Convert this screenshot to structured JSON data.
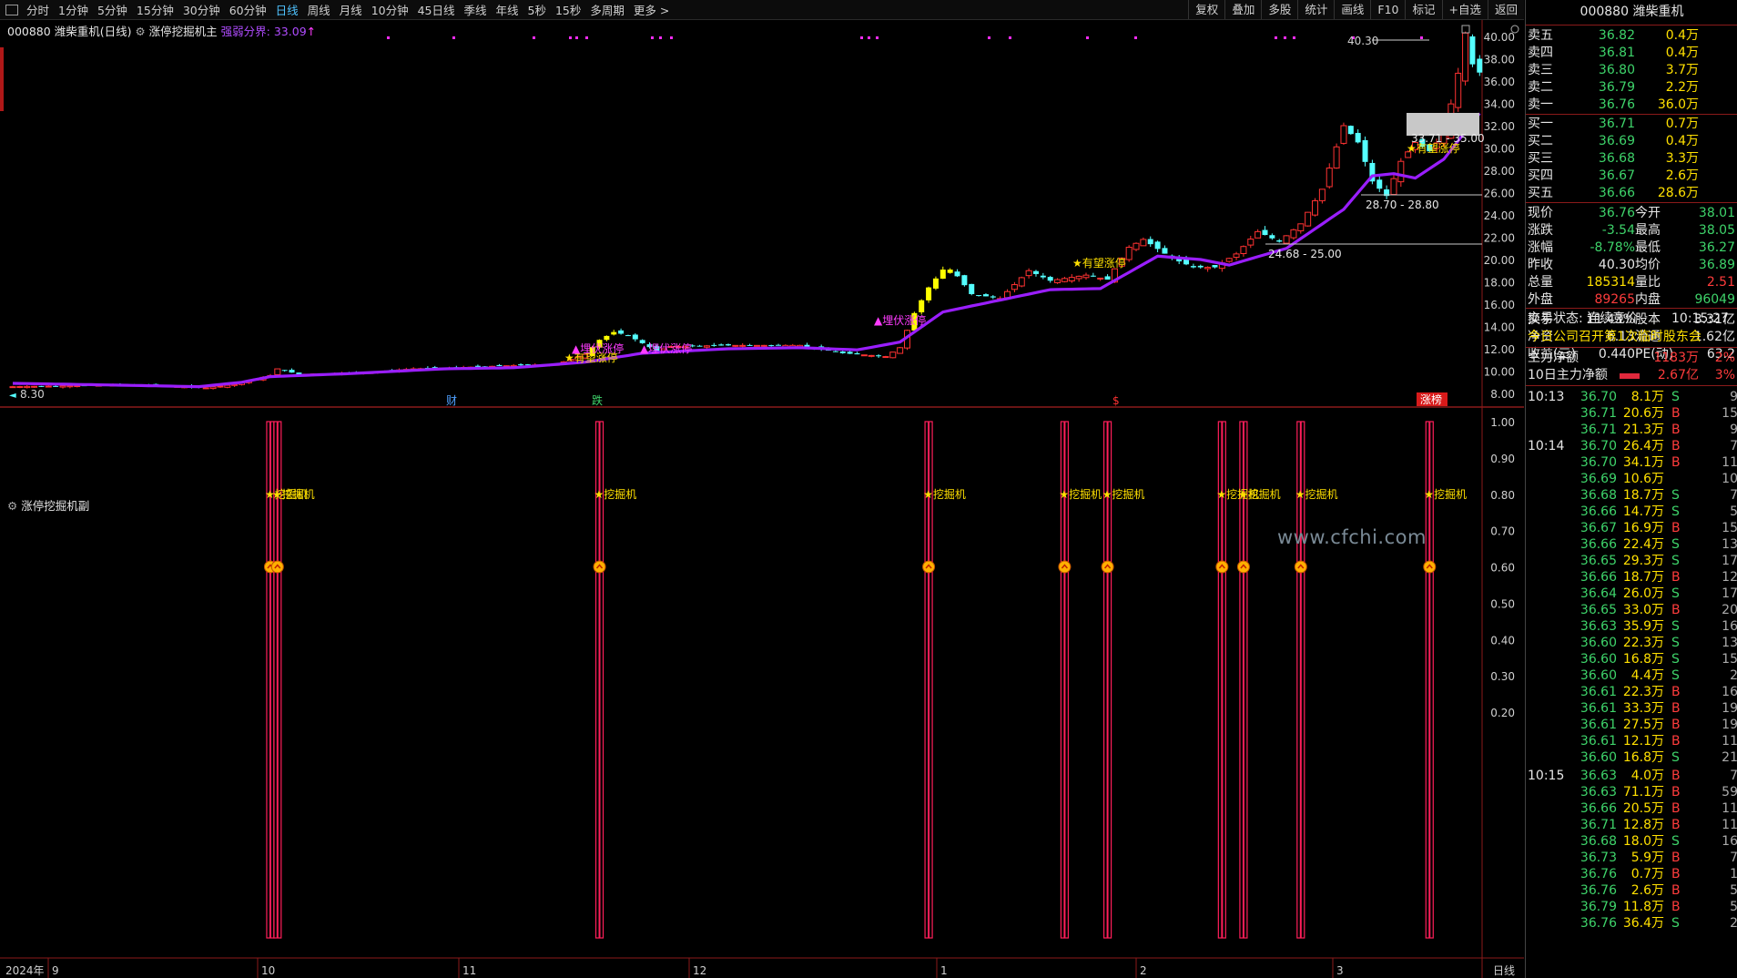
{
  "stock": {
    "code": "000880",
    "name": "潍柴重机",
    "period_label": "(日线)"
  },
  "toolbar": {
    "periods": [
      "分时",
      "1分钟",
      "5分钟",
      "15分钟",
      "30分钟",
      "60分钟",
      "日线",
      "周线",
      "月线",
      "10分钟",
      "45日线",
      "季线",
      "年线",
      "5秒",
      "15秒",
      "多周期",
      "更多 >"
    ],
    "active_period": "日线",
    "tools": [
      "复权",
      "叠加",
      "多股",
      "统计",
      "画线",
      "F10",
      "标记",
      "+自选",
      "返回"
    ]
  },
  "main_panel": {
    "indicator": "涨停挖掘机主",
    "gauge_label": "强弱分界: 33.09",
    "gauge_arrow": "↑"
  },
  "sub_panel": {
    "indicator": "涨停挖掘机副",
    "signal_label": "★挖掘机"
  },
  "watermark": "www.cfchi.com",
  "colors": {
    "up": "#ff3232",
    "down": "#54ffff",
    "ma": "#9a1eff",
    "highlight": "#ffff00",
    "signal": "#ff1e5a"
  },
  "annotations": {
    "top_price": "40.30",
    "box_label": "33.71 - 35.00",
    "level_label_1": "28.70 - 28.80",
    "level_label_2": "24.68 - 25.00",
    "low_price": "8.30",
    "hope": "★有望涨停",
    "ambush": "▲埋伏涨停",
    "event_cai": "财",
    "event_die": "跌",
    "event_s": "$",
    "event_zhang": "涨榜"
  },
  "x_axis": {
    "year": "2024年",
    "months": [
      "9",
      "10",
      "11",
      "12",
      "1",
      "2",
      "3"
    ],
    "period_tag": "日线"
  },
  "chart_data": {
    "type": "candlestick",
    "y_axis_main": {
      "min": 8,
      "max": 40,
      "ticks": [
        "40.00",
        "38.00",
        "36.00",
        "34.00",
        "32.00",
        "30.00",
        "28.00",
        "26.00",
        "24.00",
        "22.00",
        "20.00",
        "18.00",
        "16.00",
        "14.00",
        "12.00",
        "10.00",
        "8.00"
      ]
    },
    "y_axis_sub": {
      "min": 0.2,
      "max": 1.0,
      "ticks": [
        "1.00",
        "0.90",
        "0.80",
        "0.70",
        "0.60",
        "0.50",
        "0.40",
        "0.30",
        "0.20"
      ]
    },
    "ohlc_anchors": [
      {
        "i": 0,
        "c": 8.6
      },
      {
        "i": 10,
        "c": 8.7
      },
      {
        "i": 17,
        "c": 8.8
      },
      {
        "i": 27,
        "c": 8.5
      },
      {
        "i": 31,
        "c": 8.8
      },
      {
        "i": 36,
        "c": 9.6
      },
      {
        "i": 37,
        "c": 10.2
      },
      {
        "i": 40,
        "c": 9.7
      },
      {
        "i": 50,
        "c": 9.9
      },
      {
        "i": 56,
        "c": 10.2
      },
      {
        "i": 62,
        "c": 10.3
      },
      {
        "i": 70,
        "c": 10.5
      },
      {
        "i": 76,
        "c": 10.6
      },
      {
        "i": 80,
        "c": 11.5
      },
      {
        "i": 82,
        "c": 12.8
      },
      {
        "i": 84,
        "c": 13.5
      },
      {
        "i": 86,
        "c": 13.2
      },
      {
        "i": 88,
        "c": 12.5
      },
      {
        "i": 90,
        "c": 11.8
      },
      {
        "i": 92,
        "c": 12.2
      },
      {
        "i": 100,
        "c": 12.3
      },
      {
        "i": 110,
        "c": 12.3
      },
      {
        "i": 116,
        "c": 11.6
      },
      {
        "i": 122,
        "c": 11.3
      },
      {
        "i": 124,
        "c": 12.1
      },
      {
        "i": 126,
        "c": 15.2
      },
      {
        "i": 128,
        "c": 17.5
      },
      {
        "i": 130,
        "c": 19.1
      },
      {
        "i": 132,
        "c": 18.5
      },
      {
        "i": 134,
        "c": 16.9
      },
      {
        "i": 138,
        "c": 16.5
      },
      {
        "i": 142,
        "c": 19.0
      },
      {
        "i": 145,
        "c": 18.1
      },
      {
        "i": 150,
        "c": 18.6
      },
      {
        "i": 153,
        "c": 18.2
      },
      {
        "i": 156,
        "c": 21.1
      },
      {
        "i": 158,
        "c": 21.8
      },
      {
        "i": 162,
        "c": 20.1
      },
      {
        "i": 165,
        "c": 19.3
      },
      {
        "i": 168,
        "c": 19.3
      },
      {
        "i": 171,
        "c": 20.5
      },
      {
        "i": 174,
        "c": 22.5
      },
      {
        "i": 177,
        "c": 21.6
      },
      {
        "i": 180,
        "c": 23.2
      },
      {
        "i": 183,
        "c": 26.3
      },
      {
        "i": 186,
        "c": 32.0
      },
      {
        "i": 188,
        "c": 30.5
      },
      {
        "i": 190,
        "c": 27.0
      },
      {
        "i": 192,
        "c": 25.7
      },
      {
        "i": 194,
        "c": 28.8
      },
      {
        "i": 196,
        "c": 30.5
      },
      {
        "i": 198,
        "c": 29.7
      },
      {
        "i": 200,
        "c": 31.2
      },
      {
        "i": 202,
        "c": 36.7
      },
      {
        "i": 203,
        "c": 40.3
      },
      {
        "i": 204,
        "c": 37.5
      },
      {
        "i": 205,
        "c": 36.76
      }
    ],
    "ma_anchors": [
      {
        "i": 0,
        "v": 8.9
      },
      {
        "i": 14,
        "v": 8.75
      },
      {
        "i": 26,
        "v": 8.6
      },
      {
        "i": 32,
        "v": 9.0
      },
      {
        "i": 36,
        "v": 9.5
      },
      {
        "i": 48,
        "v": 9.8
      },
      {
        "i": 60,
        "v": 10.2
      },
      {
        "i": 70,
        "v": 10.3
      },
      {
        "i": 80,
        "v": 10.8
      },
      {
        "i": 88,
        "v": 11.6
      },
      {
        "i": 100,
        "v": 12.0
      },
      {
        "i": 110,
        "v": 12.1
      },
      {
        "i": 118,
        "v": 11.9
      },
      {
        "i": 124,
        "v": 12.6
      },
      {
        "i": 130,
        "v": 15.3
      },
      {
        "i": 136,
        "v": 16.1
      },
      {
        "i": 145,
        "v": 17.3
      },
      {
        "i": 152,
        "v": 17.4
      },
      {
        "i": 160,
        "v": 20.3
      },
      {
        "i": 166,
        "v": 20.0
      },
      {
        "i": 170,
        "v": 19.5
      },
      {
        "i": 178,
        "v": 21.0
      },
      {
        "i": 186,
        "v": 24.5
      },
      {
        "i": 190,
        "v": 27.5
      },
      {
        "i": 193,
        "v": 27.7
      },
      {
        "i": 196,
        "v": 27.3
      },
      {
        "i": 200,
        "v": 29.0
      },
      {
        "i": 205,
        "v": 33.1
      }
    ],
    "limit_up_bars": [
      81,
      82,
      83,
      84,
      126,
      127,
      128,
      129,
      130,
      131
    ],
    "signal_bars": [
      36,
      37,
      82,
      128,
      147,
      153,
      169,
      172,
      180,
      198
    ]
  },
  "quote": {
    "title": "000880 潍柴重机",
    "sells": [
      {
        "label": "卖五",
        "price": "36.82",
        "vol": "0.4万"
      },
      {
        "label": "卖四",
        "price": "36.81",
        "vol": "0.4万"
      },
      {
        "label": "卖三",
        "price": "36.80",
        "vol": "3.7万"
      },
      {
        "label": "卖二",
        "price": "36.79",
        "vol": "2.2万"
      },
      {
        "label": "卖一",
        "price": "36.76",
        "vol": "36.0万"
      }
    ],
    "buys": [
      {
        "label": "买一",
        "price": "36.71",
        "vol": "0.7万"
      },
      {
        "label": "买二",
        "price": "36.69",
        "vol": "0.4万"
      },
      {
        "label": "买三",
        "price": "36.68",
        "vol": "3.3万"
      },
      {
        "label": "买四",
        "price": "36.67",
        "vol": "2.6万"
      },
      {
        "label": "买五",
        "price": "36.66",
        "vol": "28.6万"
      }
    ],
    "stats": [
      {
        "l1": "现价",
        "v1": "36.76",
        "c1": "green",
        "l2": "今开",
        "v2": "38.01",
        "c2": "green"
      },
      {
        "l1": "涨跌",
        "v1": "-3.54",
        "c1": "green",
        "l2": "最高",
        "v2": "38.05",
        "c2": "green"
      },
      {
        "l1": "涨幅",
        "v1": "-8.78%",
        "c1": "green",
        "l2": "最低",
        "v2": "36.27",
        "c2": "green"
      },
      {
        "l1": "昨收",
        "v1": "40.30",
        "c1": "white",
        "l2": "均价",
        "v2": "36.89",
        "c2": "green"
      },
      {
        "l1": "总量",
        "v1": "185314",
        "c1": "yellow",
        "l2": "量比",
        "v2": "2.51",
        "c2": "red"
      },
      {
        "l1": "外盘",
        "v1": "89265",
        "c1": "red",
        "l2": "内盘",
        "v2": "96049",
        "c2": "green"
      },
      {
        "l1": "换手",
        "v1": "11.43%",
        "c1": "white",
        "l2": "股本",
        "v2": "3.31亿",
        "c2": "white"
      },
      {
        "l1": "净资",
        "v1": "6.13",
        "c1": "white",
        "l2": "流通",
        "v2": "1.62亿",
        "c2": "white"
      },
      {
        "l1": "收益(三)",
        "v1": "0.440",
        "c1": "white",
        "l2": "PE(动)",
        "v2": "63.2",
        "c2": "white"
      }
    ],
    "trade_status": "交易状态: 连续竞价",
    "trade_time": "10:15:27",
    "notice": "今日公司召开第1次临时股东会",
    "main_net_label": "主力净额",
    "main_net_value": "1183万",
    "main_net_pct": "2%",
    "main_net10_label": "10日主力净额",
    "main_net10_value": "2.67亿",
    "main_net10_pct": "3%",
    "ticks": [
      {
        "t": "10:13",
        "p": "36.70",
        "v": "8.1万",
        "s": "S",
        "n": "9"
      },
      {
        "t": "",
        "p": "36.71",
        "v": "20.6万",
        "s": "B",
        "n": "15"
      },
      {
        "t": "",
        "p": "36.71",
        "v": "21.3万",
        "s": "B",
        "n": "9"
      },
      {
        "t": "10:14",
        "p": "36.70",
        "v": "26.4万",
        "s": "B",
        "n": "7"
      },
      {
        "t": "",
        "p": "36.70",
        "v": "34.1万",
        "s": "B",
        "n": "11"
      },
      {
        "t": "",
        "p": "36.69",
        "v": "10.6万",
        "s": "",
        "n": "10"
      },
      {
        "t": "",
        "p": "36.68",
        "v": "18.7万",
        "s": "S",
        "n": "7"
      },
      {
        "t": "",
        "p": "36.66",
        "v": "14.7万",
        "s": "S",
        "n": "5"
      },
      {
        "t": "",
        "p": "36.67",
        "v": "16.9万",
        "s": "B",
        "n": "15"
      },
      {
        "t": "",
        "p": "36.66",
        "v": "22.4万",
        "s": "S",
        "n": "13"
      },
      {
        "t": "",
        "p": "36.65",
        "v": "29.3万",
        "s": "S",
        "n": "17"
      },
      {
        "t": "",
        "p": "36.66",
        "v": "18.7万",
        "s": "B",
        "n": "12"
      },
      {
        "t": "",
        "p": "36.64",
        "v": "26.0万",
        "s": "S",
        "n": "17"
      },
      {
        "t": "",
        "p": "36.65",
        "v": "33.0万",
        "s": "B",
        "n": "20"
      },
      {
        "t": "",
        "p": "36.63",
        "v": "35.9万",
        "s": "S",
        "n": "16"
      },
      {
        "t": "",
        "p": "36.60",
        "v": "22.3万",
        "s": "S",
        "n": "13"
      },
      {
        "t": "",
        "p": "36.60",
        "v": "16.8万",
        "s": "S",
        "n": "15"
      },
      {
        "t": "",
        "p": "36.60",
        "v": "4.4万",
        "s": "S",
        "n": "2"
      },
      {
        "t": "",
        "p": "36.61",
        "v": "22.3万",
        "s": "B",
        "n": "16"
      },
      {
        "t": "",
        "p": "36.61",
        "v": "33.3万",
        "s": "B",
        "n": "19"
      },
      {
        "t": "",
        "p": "36.61",
        "v": "27.5万",
        "s": "B",
        "n": "19"
      },
      {
        "t": "",
        "p": "36.61",
        "v": "12.1万",
        "s": "B",
        "n": "11"
      },
      {
        "t": "",
        "p": "36.60",
        "v": "16.8万",
        "s": "S",
        "n": "21"
      },
      {
        "t": "10:15",
        "p": "36.63",
        "v": "4.0万",
        "s": "B",
        "n": "7"
      },
      {
        "t": "",
        "p": "36.63",
        "v": "71.1万",
        "s": "B",
        "n": "59"
      },
      {
        "t": "",
        "p": "36.66",
        "v": "20.5万",
        "s": "B",
        "n": "11"
      },
      {
        "t": "",
        "p": "36.71",
        "v": "12.8万",
        "s": "B",
        "n": "11"
      },
      {
        "t": "",
        "p": "36.68",
        "v": "18.0万",
        "s": "S",
        "n": "16"
      },
      {
        "t": "",
        "p": "36.73",
        "v": "5.9万",
        "s": "B",
        "n": "7"
      },
      {
        "t": "",
        "p": "36.76",
        "v": "0.7万",
        "s": "B",
        "n": "1"
      },
      {
        "t": "",
        "p": "36.76",
        "v": "2.6万",
        "s": "B",
        "n": "5"
      },
      {
        "t": "",
        "p": "36.79",
        "v": "11.8万",
        "s": "B",
        "n": "5"
      },
      {
        "t": "",
        "p": "36.76",
        "v": "36.4万",
        "s": "S",
        "n": "2"
      }
    ]
  }
}
